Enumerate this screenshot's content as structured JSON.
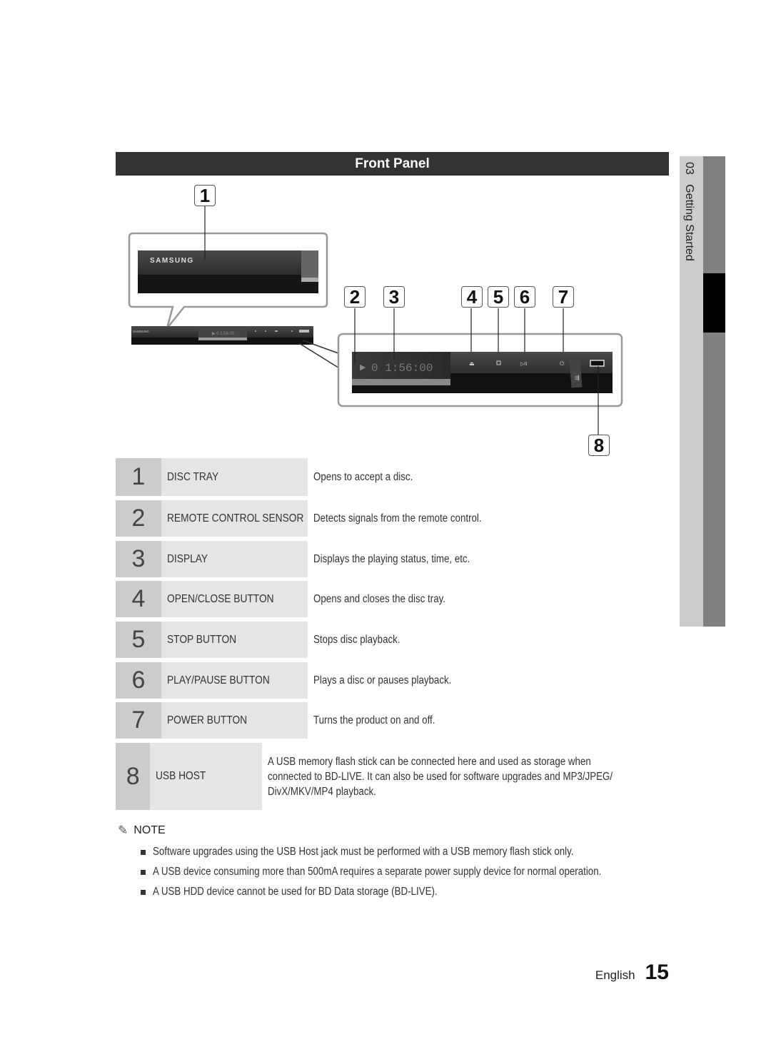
{
  "section": {
    "title": "Front Panel"
  },
  "side_tab": {
    "chapter": "03",
    "label": "Getting Started"
  },
  "figure": {
    "brand_text": "SAMSUNG",
    "display_readout": "0 1:56:00",
    "callouts": [
      "1",
      "2",
      "3",
      "4",
      "5",
      "6",
      "7",
      "8"
    ],
    "button_icons": [
      "eject-icon",
      "stop-icon",
      "play-pause-icon",
      "power-icon",
      "usb-icon"
    ]
  },
  "parts": [
    {
      "num": "1",
      "name": "DISC TRAY",
      "desc": "Opens to accept a disc."
    },
    {
      "num": "2",
      "name": "REMOTE CONTROL SENSOR",
      "desc": "Detects signals from the remote control."
    },
    {
      "num": "3",
      "name": "DISPLAY",
      "desc": "Displays the playing status, time, etc."
    },
    {
      "num": "4",
      "name": "OPEN/CLOSE BUTTON",
      "desc": "Opens and closes the disc tray."
    },
    {
      "num": "5",
      "name": "STOP BUTTON",
      "desc": "Stops disc playback."
    },
    {
      "num": "6",
      "name": "PLAY/PAUSE BUTTON",
      "desc": "Plays a disc or pauses playback."
    },
    {
      "num": "7",
      "name": "POWER BUTTON",
      "desc": "Turns the product on and off."
    },
    {
      "num": "8",
      "name": "USB HOST",
      "desc_lines": [
        "A USB memory flash stick can be connected here and used as storage when",
        "connected to BD-LIVE. It can also be used for software upgrades and MP3/JPEG/",
        "DivX/MKV/MP4 playback."
      ]
    }
  ],
  "note": {
    "title": "NOTE",
    "items": [
      "Software upgrades using the USB Host jack must be performed with a USB memory flash stick only.",
      "A USB device consuming more than 500mA requires a separate power supply device for normal operation.",
      "A USB HDD device cannot be used for BD Data storage (BD-LIVE)."
    ]
  },
  "footer": {
    "language": "English",
    "page_number": "15"
  }
}
